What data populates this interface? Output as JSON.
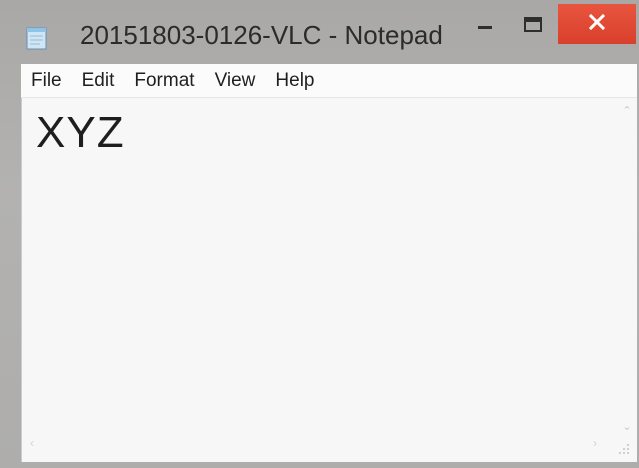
{
  "window": {
    "title": "20151803-0126-VLC - Notepad",
    "icon": "notepad-icon",
    "buttons": {
      "minimize_icon": "minimize-icon",
      "maximize_icon": "maximize-icon",
      "close_icon": "close-icon",
      "close_color": "#e04a35"
    }
  },
  "menu": {
    "items": [
      {
        "label": "File"
      },
      {
        "label": "Edit"
      },
      {
        "label": "Format"
      },
      {
        "label": "View"
      },
      {
        "label": "Help"
      }
    ]
  },
  "editor": {
    "content": "XYZ"
  }
}
